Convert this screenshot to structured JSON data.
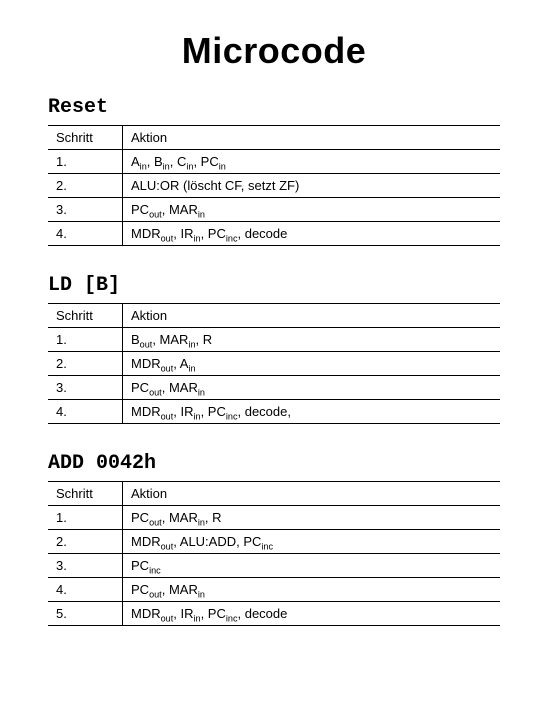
{
  "title": "Microcode",
  "columns": {
    "step": "Schritt",
    "action": "Aktion"
  },
  "sections": [
    {
      "name": "Reset",
      "rows": [
        {
          "step": "1.",
          "action": "A<sub>in</sub>, B<sub>in</sub>, C<sub>in</sub>, PC<sub>in</sub>"
        },
        {
          "step": "2.",
          "action": "ALU:OR (löscht CF, setzt ZF)"
        },
        {
          "step": "3.",
          "action": "PC<sub>out</sub>, MAR<sub>in</sub>"
        },
        {
          "step": "4.",
          "action": "MDR<sub>out</sub>, IR<sub>in</sub>, PC<sub>inc</sub>, decode"
        }
      ]
    },
    {
      "name": "LD [B]",
      "rows": [
        {
          "step": "1.",
          "action": "B<sub>out</sub>, MAR<sub>in</sub>, R"
        },
        {
          "step": "2.",
          "action": "MDR<sub>out</sub>, A<sub>in</sub>"
        },
        {
          "step": "3.",
          "action": "PC<sub>out</sub>, MAR<sub>in</sub>"
        },
        {
          "step": "4.",
          "action": "MDR<sub>out</sub>, IR<sub>in</sub>, PC<sub>inc</sub>, decode,"
        }
      ]
    },
    {
      "name": "ADD 0042h",
      "rows": [
        {
          "step": "1.",
          "action": "PC<sub>out</sub>, MAR<sub>in</sub>, R"
        },
        {
          "step": "2.",
          "action": "MDR<sub>out</sub>, ALU:ADD, PC<sub>inc</sub>"
        },
        {
          "step": "3.",
          "action": "PC<sub>inc</sub>"
        },
        {
          "step": "4.",
          "action": "PC<sub>out</sub>, MAR<sub>in</sub>"
        },
        {
          "step": "5.",
          "action": "MDR<sub>out</sub>, IR<sub>in</sub>, PC<sub>inc</sub>, decode"
        }
      ]
    }
  ]
}
